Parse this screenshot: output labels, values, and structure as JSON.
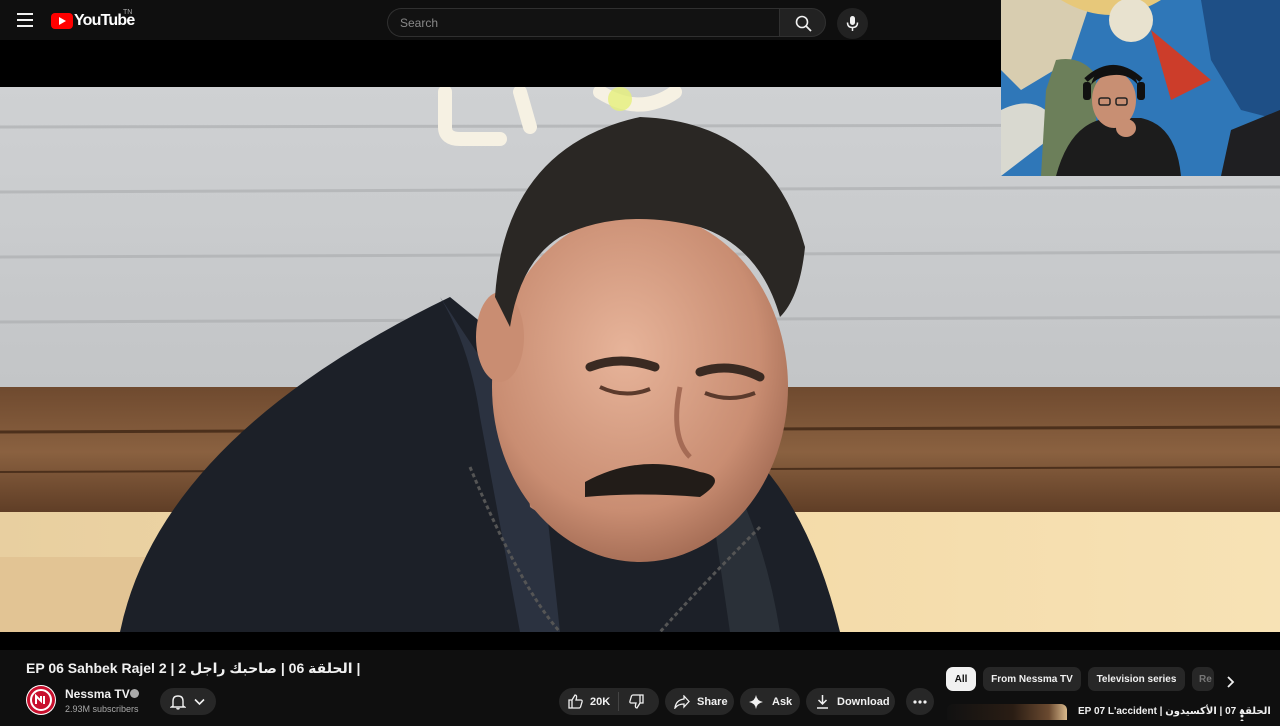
{
  "header": {
    "logo_text": "YouTube",
    "logo_country": "TN",
    "search_placeholder": "Search"
  },
  "video": {
    "title": "EP 06 Sahbek Rajel 2 | الحلقة 06 | صاحبك راجل 2 |"
  },
  "channel": {
    "name": "Nessma TV",
    "subscribers": "2.93M subscribers"
  },
  "actions": {
    "likes": "20K",
    "share": "Share",
    "ask": "Ask",
    "download": "Download"
  },
  "chips": [
    "All",
    "From Nessma TV",
    "Television series",
    "Re"
  ],
  "recommendations": [
    {
      "title": "EP 07 L'accident | الحلقة 07 | الأكسيدون"
    }
  ],
  "colors": {
    "background": "#0f0f0f",
    "brand_red": "#ff0000",
    "pill_bg": "#272727",
    "active_chip_bg": "#f1f1f1"
  }
}
